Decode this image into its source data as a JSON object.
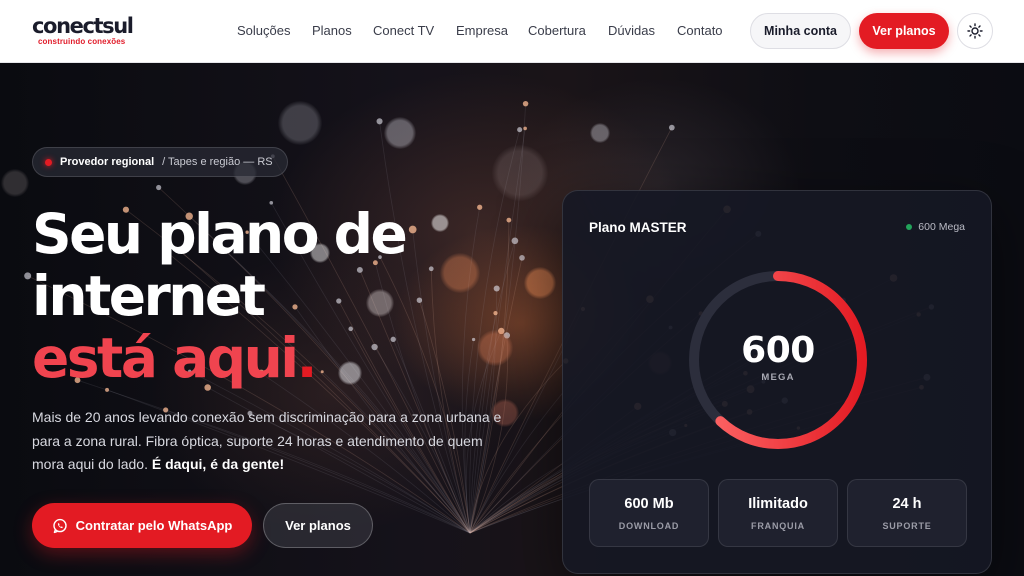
{
  "brand": {
    "name": "conectsul",
    "tagline": "construindo conexões",
    "accent_color": "#e31b23"
  },
  "nav": {
    "links": [
      "Soluções",
      "Planos",
      "Conect TV",
      "Empresa",
      "Cobertura",
      "Dúvidas",
      "Contato"
    ],
    "account_label": "Minha conta",
    "plans_label": "Ver planos",
    "theme_icon": "sun-icon"
  },
  "hero": {
    "badge_strong": "Provedor regional",
    "badge_sub": "/ Tapes e região — RS",
    "headline_line1": "Seu plano de",
    "headline_line2": "internet",
    "headline_accent": "está aqui",
    "headline_dot": ".",
    "description": "Mais de 20 anos levando conexão sem discriminação para a zona urbana e para a zona rural. Fibra óptica, suporte 24 horas e atendimento de quem mora aqui do lado.",
    "description_bold": "É daqui, é da gente!",
    "whatsapp_label": "Contratar pelo WhatsApp",
    "whatsapp_icon": "whatsapp-icon",
    "plans_label": "Ver planos"
  },
  "plan_card": {
    "title": "Plano MASTER",
    "speed_tag": "600 Mega",
    "gauge_value": "600",
    "gauge_unit": "MEGA",
    "gauge_fill_fraction": 0.62,
    "stats": [
      {
        "value": "600 Mb",
        "label": "DOWNLOAD"
      },
      {
        "value": "Ilimitado",
        "label": "FRANQUIA"
      },
      {
        "value": "24 h",
        "label": "SUPORTE"
      }
    ]
  }
}
